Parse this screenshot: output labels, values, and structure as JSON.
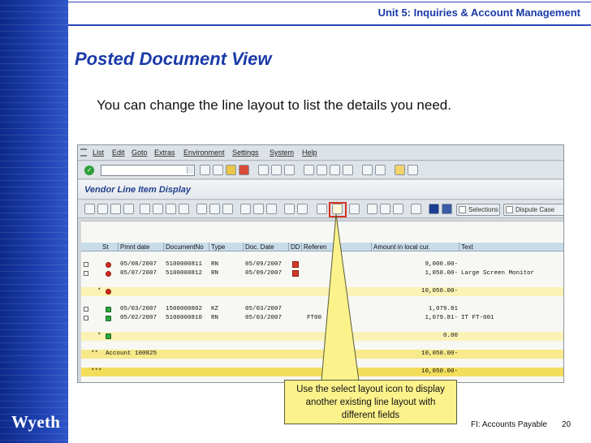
{
  "slide": {
    "unit_title": "Unit 5: Inquiries & Account Management",
    "title": "Posted Document View",
    "intro": "You can change the line layout to list the details you need.",
    "callout": "Use the select layout icon to display another existing line layout with different fields",
    "footer_course": "FI: Accounts Payable",
    "page_number": "20",
    "logo": "Wyeth"
  },
  "sap": {
    "menu": [
      "List",
      "Edit",
      "Goto",
      "Extras",
      "Environment",
      "Settings",
      "System",
      "Help"
    ],
    "screen_title": "Vendor Line Item Display",
    "buttons": {
      "selections": "Selections",
      "dispute_case": "Dispute Case"
    },
    "columns": [
      "St",
      "Pmnt date",
      "DocumentNo",
      "Type",
      "Doc. Date",
      "DD",
      "Referen",
      "Amount in local cur.",
      "Text"
    ],
    "rows": [
      {
        "kind": "item",
        "status": "red",
        "pmnt_date": "05/08/2007",
        "doc_no": "5100000811",
        "type": "RN",
        "doc_date": "05/09/2007",
        "ref": "",
        "amount": "9,000.00-",
        "text": ""
      },
      {
        "kind": "item",
        "status": "red",
        "pmnt_date": "05/07/2007",
        "doc_no": "5100000812",
        "type": "RN",
        "doc_date": "05/09/2007",
        "ref": "",
        "amount": "1,050.00-",
        "text": "Large Screen Monitor"
      },
      {
        "kind": "subtotal",
        "marker": "*",
        "status": "red",
        "amount": "10,050.00-"
      },
      {
        "kind": "item",
        "status": "green",
        "pmnt_date": "05/03/2007",
        "doc_no": "1500000802",
        "type": "KZ",
        "doc_date": "05/03/2007",
        "ref": "",
        "amount": "1,079.81",
        "text": ""
      },
      {
        "kind": "item",
        "status": "green",
        "pmnt_date": "05/02/2007",
        "doc_no": "5100000810",
        "type": "RN",
        "doc_date": "05/03/2007",
        "ref": "FT00",
        "amount": "1,079.81-",
        "text": "IT FT-001"
      },
      {
        "kind": "subtotal",
        "marker": "*",
        "status": "green",
        "amount": "0.00"
      },
      {
        "kind": "total",
        "marker": "**",
        "label": "Account 100825",
        "amount": "10,050.00-"
      },
      {
        "kind": "grand",
        "marker": "***",
        "amount": "10,050.00-"
      }
    ]
  },
  "colors": {
    "brand_blue": "#1a3aa8",
    "callout_fill": "#fbf28c",
    "highlight_red": "#d8331f"
  }
}
